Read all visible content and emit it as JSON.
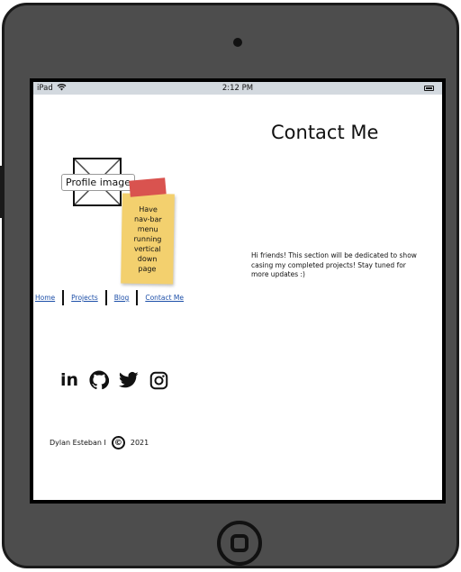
{
  "statusbar": {
    "carrier": "iPad",
    "time": "2:12 PM",
    "battery_level": 0.9
  },
  "page": {
    "title": "Contact Me"
  },
  "profile": {
    "label": "Profile image"
  },
  "sticky_note": {
    "text": "Have\nnav-bar\nmenu\nrunning\nvertical\ndown\npage"
  },
  "nav": {
    "items": [
      {
        "label": "Home"
      },
      {
        "label": "Projects"
      },
      {
        "label": "Blog"
      },
      {
        "label": "Contact Me"
      }
    ]
  },
  "social": {
    "icons": [
      "linkedin-icon",
      "github-icon",
      "twitter-icon",
      "instagram-icon"
    ]
  },
  "body": {
    "text": "Hi friends! This section will be dedicated to show casing my completed projects! Stay tuned for more updates :)"
  },
  "footer": {
    "name": "Dylan Esteban I",
    "symbol": "©",
    "year": "2021"
  },
  "colors": {
    "device": "#4d4d4d",
    "statusbar": "#d3d9df",
    "sticky": "#f3d06e",
    "tape": "#d9534f",
    "link": "#1d4fa8"
  }
}
